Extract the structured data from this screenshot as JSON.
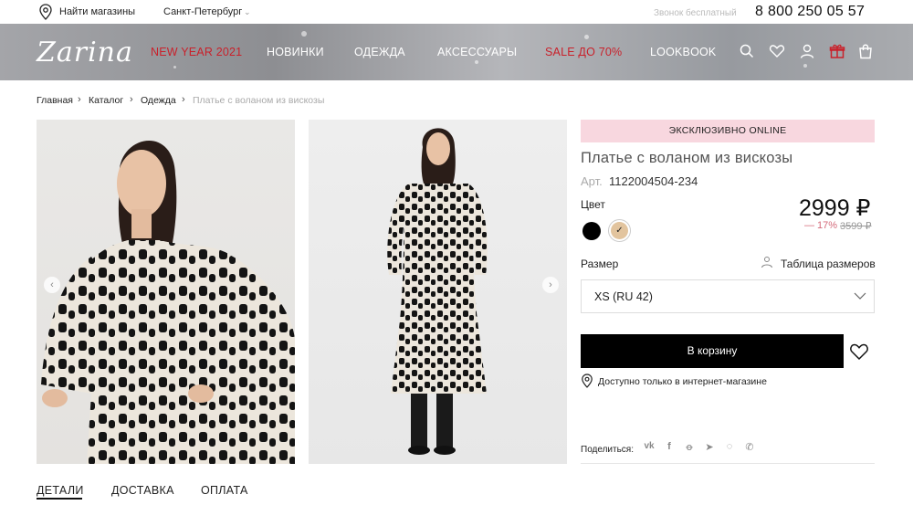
{
  "topbar": {
    "find_stores": "Найти магазины",
    "city": "Санкт-Петербург",
    "free_call": "Звонок бесплатный",
    "phone": "8 800 250 05 57"
  },
  "header": {
    "logo": "Zarina",
    "nav": [
      "NEW YEAR 2021",
      "НОВИНКИ",
      "ОДЕЖДА",
      "АКСЕССУАРЫ",
      "SALE ДО 70%",
      "LOOKBOOK"
    ],
    "icons": [
      "search-icon",
      "heart-icon",
      "user-icon",
      "gift-icon",
      "bag-icon"
    ],
    "accent_color": "#c9212b"
  },
  "breadcrumb": [
    "Главная",
    "Каталог",
    "Одежда",
    "Платье с воланом из вискозы"
  ],
  "product": {
    "badge": "ЭКСКЛЮЗИВНО ONLINE",
    "title": "Платье с воланом из вискозы",
    "article_label": "Арт.",
    "article": "1122004504-234",
    "color_label": "Цвет",
    "price": "2999 ₽",
    "discount": "— 17%",
    "old_price": "3599 ₽",
    "size_label": "Размер",
    "size_table": "Таблица размеров",
    "size_value": "XS (RU 42)",
    "cart_button": "В корзину",
    "availability": "Доступно только в интернет-магазине",
    "share_label": "Поделиться:",
    "swatches": [
      "#000000",
      "#e2c49e"
    ],
    "badge_color": "#f8d7df"
  },
  "social": [
    "vk-icon",
    "facebook-icon",
    "odnoklassniki-icon",
    "telegram-icon",
    "whatsapp-icon",
    "viber-icon"
  ],
  "tabs": [
    "ДЕТАЛИ",
    "ДОСТАВКА",
    "ОПЛАТА"
  ]
}
